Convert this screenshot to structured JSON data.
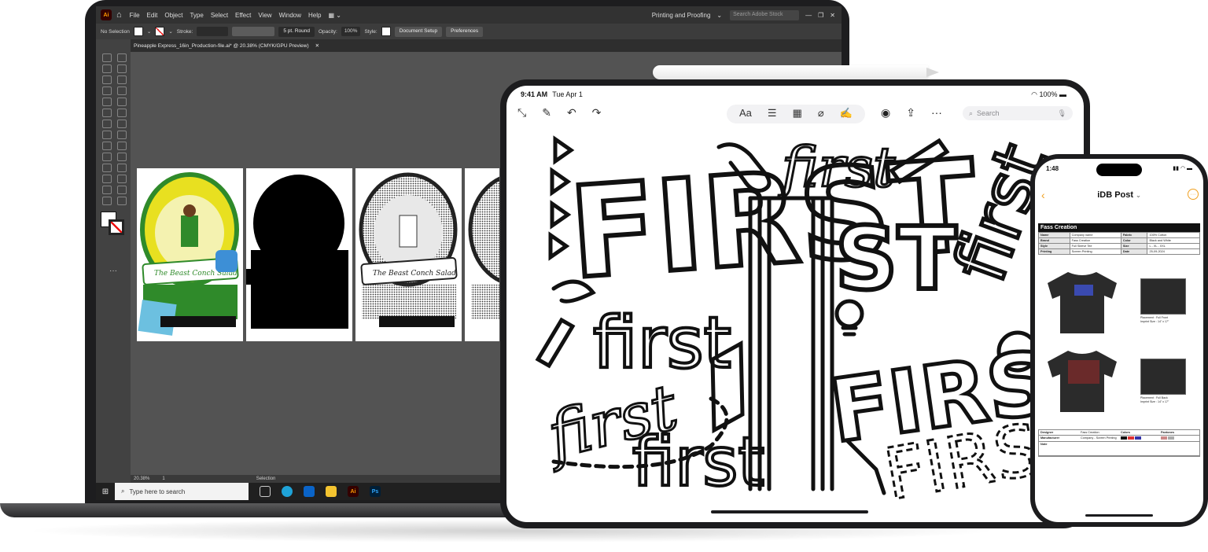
{
  "illustrator": {
    "logo": "Ai",
    "menu": [
      "File",
      "Edit",
      "Object",
      "Type",
      "Select",
      "Effect",
      "View",
      "Window",
      "Help"
    ],
    "workspace": "Printing and Proofing",
    "search_placeholder": "Search Adobe Stock",
    "control": {
      "selection": "No Selection",
      "stroke_label": "Stroke:",
      "brush": "5 pt. Round",
      "opacity_label": "Opacity:",
      "opacity_value": "100%",
      "style_label": "Style:",
      "document_setup": "Document Setup",
      "preferences": "Preferences"
    },
    "document_tab": "Pineapple Express_16in_Production-file.ai* @ 20.38% (CMYK/GPU Preview)",
    "artwork_text": "The Beast Conch Salad",
    "artboards": [
      "color",
      "black-mask",
      "halftone",
      "halftone-partial"
    ],
    "status": {
      "zoom": "20.38%",
      "artboard": "1",
      "tool": "Selection"
    }
  },
  "taskbar": {
    "search_placeholder": "Type here to search"
  },
  "tablet": {
    "time": "9:41 AM",
    "date": "Tue Apr 1",
    "battery": "100%",
    "text_tool": "Aa",
    "search_placeholder": "Search",
    "artwork_word": "first",
    "artwork_word_caps": "FIRST",
    "artwork_fragment": "ST"
  },
  "phone": {
    "time": "1:48",
    "title": "iDB Post",
    "sheet": {
      "heading": "Fass Creation",
      "rows": [
        [
          "Name",
          "Company name",
          "Fabric",
          "100% Cotton"
        ],
        [
          "Brand",
          "Fass Creation",
          "Color",
          "Black and White"
        ],
        [
          "Style",
          "Full Sleeve Tee",
          "Size",
          "L - XL - XXL"
        ],
        [
          "Printing",
          "Screen Printing",
          "Date",
          "25-09-2024"
        ]
      ],
      "front_caption": "Placement : Full Front\nImprint Size : 14\" x 17\"",
      "back_caption": "Placement : Full Back\nImprint Size : 14\" x 17\"",
      "footer": {
        "designer_label": "Designer",
        "designer_value": "Fass Creation",
        "manufacturer_label": "Manufacturer",
        "manufacturer_value": "Company - Screen Printing",
        "colors_label": "Colors",
        "pantones_label": "Pantones",
        "note_label": "Note"
      }
    }
  },
  "colors": {
    "ai_orange": "#ff9a00",
    "ios_accent": "#f0a020",
    "artwork_yellow": "#e8e020",
    "artwork_green": "#2f8a2a"
  }
}
